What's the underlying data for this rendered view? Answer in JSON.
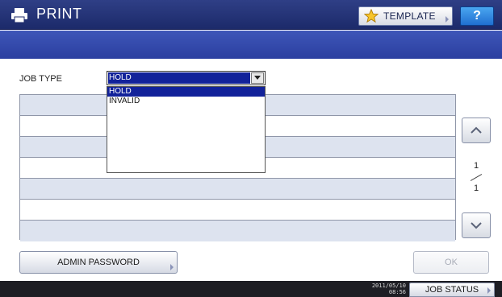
{
  "header": {
    "title": "PRINT",
    "title_icon": "printer-icon",
    "template_label": "TEMPLATE",
    "template_icon": "star-icon",
    "help_label": "?"
  },
  "job_type": {
    "label": "JOB TYPE",
    "selected": "HOLD",
    "options": [
      "HOLD",
      "INVALID"
    ]
  },
  "pagination": {
    "current": "1",
    "total": "1"
  },
  "buttons": {
    "admin_password": "ADMIN PASSWORD",
    "ok": "OK",
    "job_status": "JOB STATUS"
  },
  "status": {
    "date": "2011/05/10",
    "time": "08:56"
  },
  "colors": {
    "title_bar": "#1c2a6a",
    "banner": "#2b3fa0",
    "selection": "#12229a",
    "row_shade": "#dde3ef",
    "help_button": "#1f6fd0"
  }
}
